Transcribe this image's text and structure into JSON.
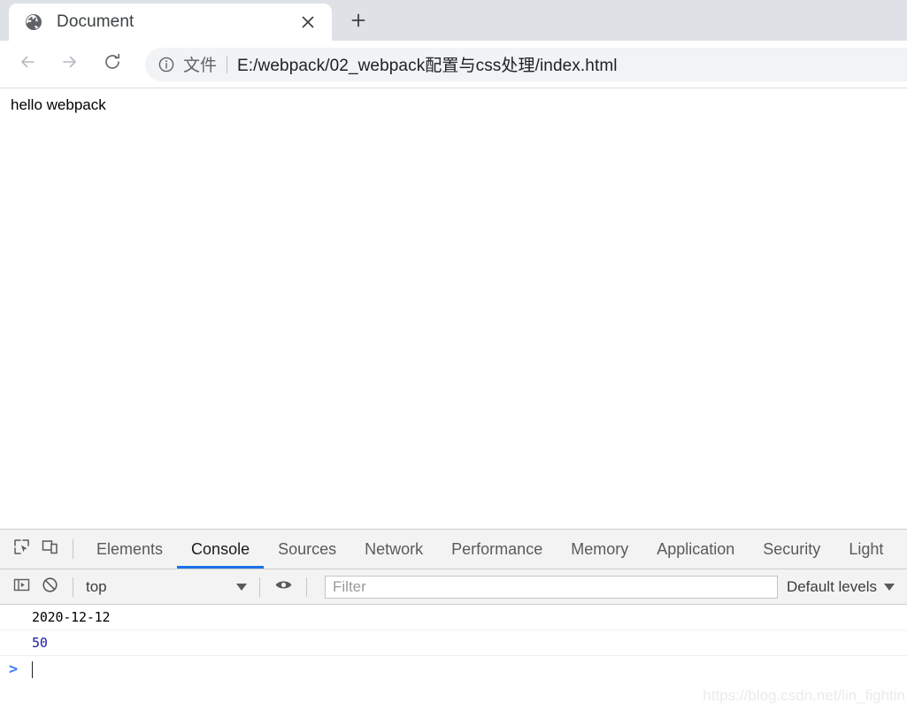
{
  "browser": {
    "tab": {
      "title": "Document",
      "favicon_icon": "globe-icon",
      "close_icon": "close-icon"
    },
    "new_tab_icon": "plus-icon",
    "nav": {
      "back_icon": "arrow-left-icon",
      "forward_icon": "arrow-right-icon",
      "reload_icon": "reload-icon"
    },
    "omnibox": {
      "info_icon": "info-circle-icon",
      "scheme_label": "文件",
      "url": "E:/webpack/02_webpack配置与css处理/index.html"
    }
  },
  "page": {
    "body_text": "hello webpack"
  },
  "devtools": {
    "inspect_icon": "inspect-element-icon",
    "device_toolbar_icon": "device-toggle-icon",
    "tabs": [
      {
        "label": "Elements",
        "active": false
      },
      {
        "label": "Console",
        "active": true
      },
      {
        "label": "Sources",
        "active": false
      },
      {
        "label": "Network",
        "active": false
      },
      {
        "label": "Performance",
        "active": false
      },
      {
        "label": "Memory",
        "active": false
      },
      {
        "label": "Application",
        "active": false
      },
      {
        "label": "Security",
        "active": false
      },
      {
        "label": "Light",
        "active": false
      }
    ],
    "console_toolbar": {
      "sidebar_toggle_icon": "console-sidebar-icon",
      "clear_console_icon": "clear-console-icon",
      "context_value": "top",
      "context_caret_icon": "chevron-down-icon",
      "eye_icon": "live-expression-eye-icon",
      "filter_placeholder": "Filter",
      "filter_value": "",
      "levels_label": "Default levels",
      "levels_caret_icon": "chevron-down-icon"
    },
    "console_messages": [
      {
        "text": "2020-12-12",
        "kind": "string"
      },
      {
        "text": "50",
        "kind": "number"
      }
    ],
    "prompt": {
      "chevron": ">"
    }
  },
  "watermark": {
    "text": "https://blog.csdn.net/lin_fightin"
  }
}
